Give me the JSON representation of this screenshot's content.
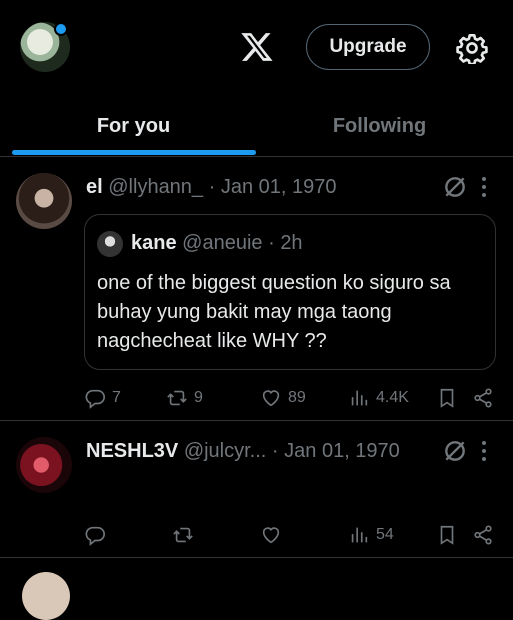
{
  "header": {
    "upgrade_label": "Upgrade"
  },
  "tabs": [
    {
      "label": "For you",
      "active": true
    },
    {
      "label": "Following",
      "active": false
    }
  ],
  "posts": [
    {
      "name": "el",
      "handle": "@llyhann_",
      "date": "Jan 01, 1970",
      "quote": {
        "name": "kane",
        "handle": "@aneuie",
        "time": "2h",
        "text": "one of the biggest question ko siguro sa buhay yung bakit may mga taong nagchecheat like WHY ??"
      },
      "stats": {
        "replies": "7",
        "reposts": "9",
        "likes": "89",
        "views": "4.4K"
      }
    },
    {
      "name": "NESHL3V",
      "handle": "@julcyr...",
      "date": "Jan 01, 1970",
      "stats": {
        "replies": "",
        "reposts": "",
        "likes": "",
        "views": "54"
      }
    }
  ],
  "colors": {
    "accent": "#1d9bf0",
    "muted": "#71767b",
    "text": "#e7e9ea",
    "border": "#2f3336"
  },
  "icons": [
    "x-logo-icon",
    "gear-icon",
    "grok-icon",
    "more-icon",
    "reply-icon",
    "repost-icon",
    "like-icon",
    "views-icon",
    "bookmark-icon",
    "share-icon"
  ]
}
